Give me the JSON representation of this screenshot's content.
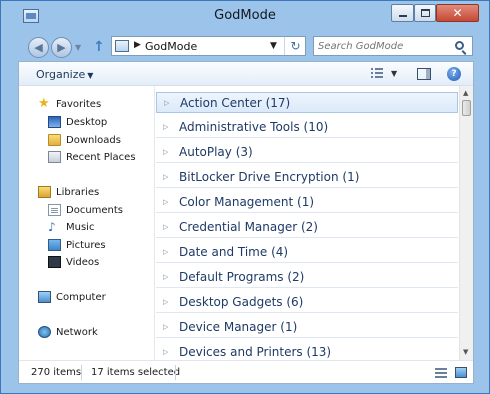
{
  "window": {
    "title": "GodMode",
    "controls": {
      "close_glyph": "✕"
    }
  },
  "navigation": {
    "back_glyph": "◀",
    "forward_glyph": "▶",
    "up_glyph": "↑",
    "address": {
      "separator": "▶",
      "path": "GodMode",
      "dropdown": "▼",
      "refresh_glyph": "↻"
    },
    "search": {
      "placeholder": "Search GodMode"
    }
  },
  "toolbar": {
    "organize_label": "Organize",
    "caret": "▼",
    "help_glyph": "?"
  },
  "nav_pane": {
    "favorites": {
      "label": "Favorites",
      "items": [
        "Desktop",
        "Downloads",
        "Recent Places"
      ]
    },
    "libraries": {
      "label": "Libraries",
      "items": [
        "Documents",
        "Music",
        "Pictures",
        "Videos"
      ]
    },
    "computer": {
      "label": "Computer"
    },
    "network": {
      "label": "Network"
    }
  },
  "groups": [
    {
      "label": "Action Center (17)",
      "selected": true
    },
    {
      "label": "Administrative Tools (10)"
    },
    {
      "label": "AutoPlay (3)"
    },
    {
      "label": "BitLocker Drive Encryption (1)"
    },
    {
      "label": "Color Management (1)"
    },
    {
      "label": "Credential Manager (2)"
    },
    {
      "label": "Date and Time (4)"
    },
    {
      "label": "Default Programs (2)"
    },
    {
      "label": "Desktop Gadgets (6)"
    },
    {
      "label": "Device Manager (1)"
    },
    {
      "label": "Devices and Printers (13)"
    }
  ],
  "group_expander": "▷",
  "status": {
    "item_count": "270 items",
    "selected_count": "17 items selected"
  },
  "colors": {
    "accent": "#3b77b9",
    "selection": "#dbe9f9",
    "close_button": "#c44a35",
    "group_text": "#1e3a66"
  }
}
